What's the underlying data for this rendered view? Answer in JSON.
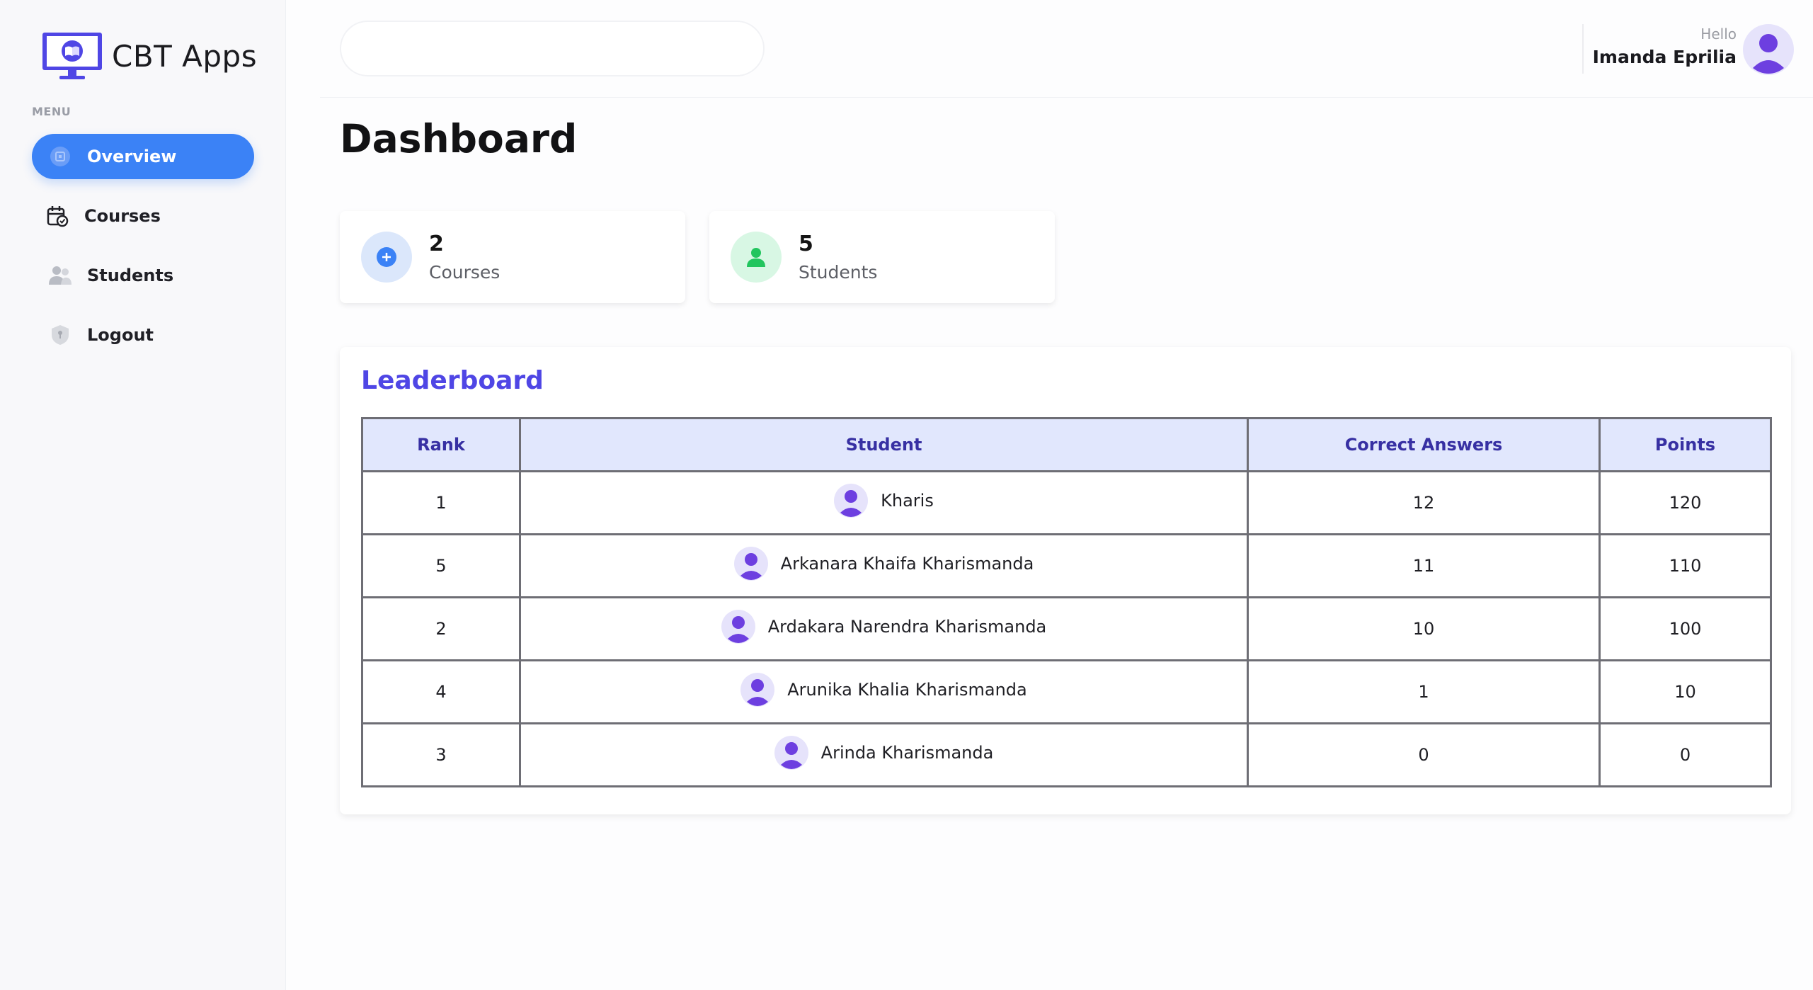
{
  "app": {
    "name": "CBT Apps",
    "colors": {
      "accent": "#3b82f6",
      "brand": "#4f46e5",
      "table_header_bg": "#e1e7fd",
      "table_header_text": "#3730a3"
    }
  },
  "sidebar": {
    "menu_label": "MENU",
    "items": [
      {
        "label": "Overview",
        "icon": "home-icon",
        "active": true
      },
      {
        "label": "Courses",
        "icon": "calendar-icon",
        "active": false
      },
      {
        "label": "Students",
        "icon": "users-icon",
        "active": false
      },
      {
        "label": "Logout",
        "icon": "shield-icon",
        "active": false
      }
    ]
  },
  "header": {
    "search_value": "",
    "greeting": "Hello",
    "user_name": "Imanda Eprilia"
  },
  "main": {
    "title": "Dashboard",
    "stats": [
      {
        "count": "2",
        "label": "Courses",
        "icon": "plus-circle-icon",
        "color": "#3b82f6"
      },
      {
        "count": "5",
        "label": "Students",
        "icon": "user-icon",
        "color": "#22c55e"
      }
    ],
    "leaderboard": {
      "title": "Leaderboard",
      "columns": [
        "Rank",
        "Student",
        "Correct Answers",
        "Points"
      ],
      "rows": [
        {
          "rank": "1",
          "student": "Kharis",
          "correct": "12",
          "points": "120"
        },
        {
          "rank": "5",
          "student": "Arkanara Khaifa Kharismanda",
          "correct": "11",
          "points": "110"
        },
        {
          "rank": "2",
          "student": "Ardakara Narendra Kharismanda",
          "correct": "10",
          "points": "100"
        },
        {
          "rank": "4",
          "student": "Arunika Khalia Kharismanda",
          "correct": "1",
          "points": "10"
        },
        {
          "rank": "3",
          "student": "Arinda Kharismanda",
          "correct": "0",
          "points": "0"
        }
      ]
    }
  }
}
